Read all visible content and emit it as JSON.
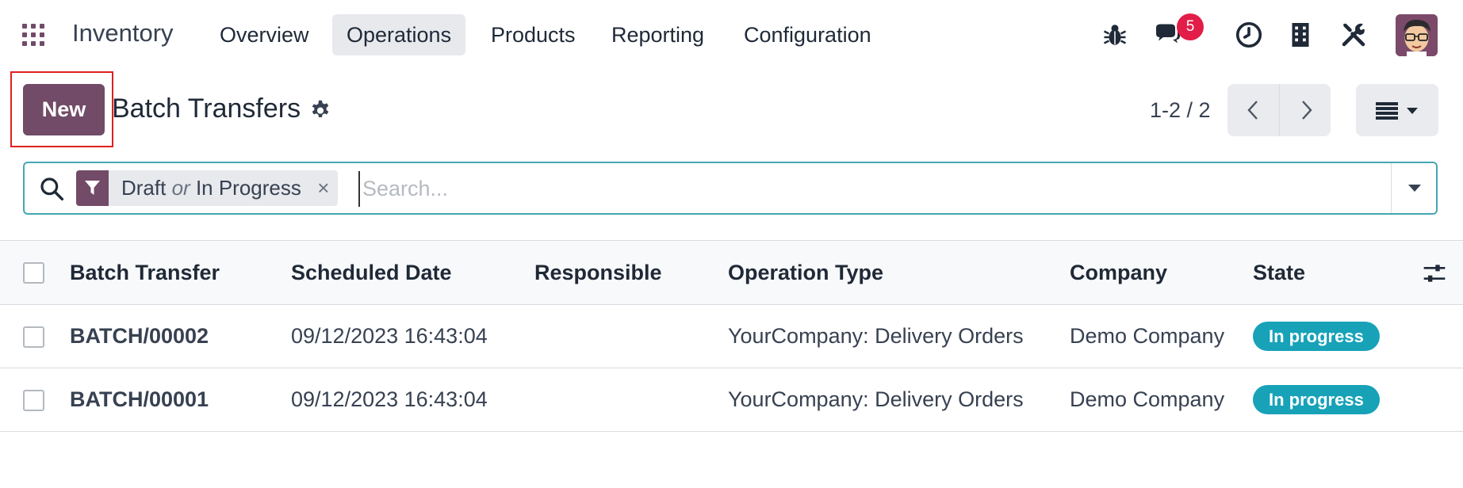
{
  "app": {
    "brand": "Inventory",
    "menu": [
      {
        "label": "Overview",
        "active": false
      },
      {
        "label": "Operations",
        "active": true
      },
      {
        "label": "Products",
        "active": false
      },
      {
        "label": "Reporting",
        "active": false
      },
      {
        "label": "Configuration",
        "active": false
      }
    ],
    "systray": {
      "icons": [
        "bug-icon",
        "chat-icon",
        "clock-icon",
        "building-icon",
        "tools-icon"
      ],
      "messages_count": "5"
    }
  },
  "control_panel": {
    "new_label": "New",
    "title": "Batch Transfers",
    "pager": "1-2 / 2"
  },
  "search": {
    "facet_parts": [
      "Draft",
      "or",
      "In Progress"
    ],
    "facet_close": "×",
    "placeholder": "Search..."
  },
  "table": {
    "columns": [
      "Batch Transfer",
      "Scheduled Date",
      "Responsible",
      "Operation Type",
      "Company",
      "State"
    ],
    "rows": [
      {
        "name": "BATCH/00002",
        "date": "09/12/2023 16:43:04",
        "responsible": "",
        "operation": "YourCompany: Delivery Orders",
        "company": "Demo Company",
        "state": "In progress"
      },
      {
        "name": "BATCH/00001",
        "date": "09/12/2023 16:43:04",
        "responsible": "",
        "operation": "YourCompany: Delivery Orders",
        "company": "Demo Company",
        "state": "In progress"
      }
    ]
  },
  "colors": {
    "brand": "#714B67",
    "state_badge": "#17a2b8",
    "notification": "#e11d48",
    "search_border": "#45a6b1"
  }
}
